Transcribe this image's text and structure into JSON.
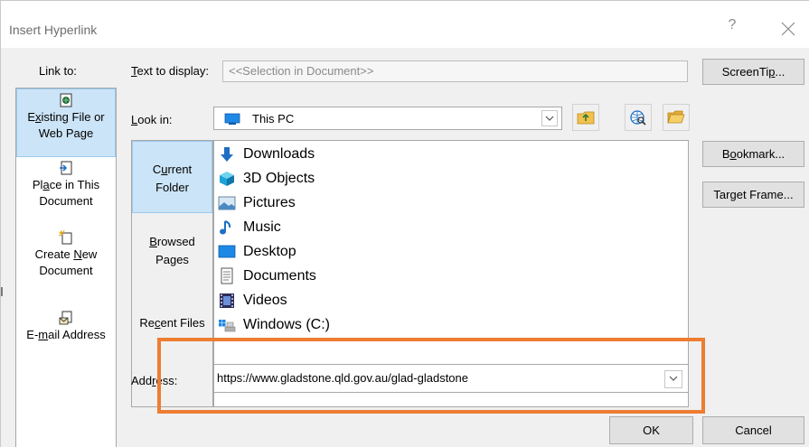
{
  "window": {
    "title": "Insert Hyperlink",
    "help_label": "?"
  },
  "link_to": {
    "label": "Link to:",
    "items": [
      {
        "line1_pre": "",
        "line1_key": "x",
        "line1_post": "isting File or",
        "line1_lead": "E",
        "line2": "Web Page",
        "icon": "existing-file-icon",
        "selected": true
      },
      {
        "line1": "Pl",
        "line1_key": "a",
        "line1_post": "ce in This",
        "line2": "Document",
        "icon": "place-in-document-icon"
      },
      {
        "line1": "Create ",
        "line1_key": "N",
        "line1_post": "ew",
        "line2": "Document",
        "icon": "create-new-document-icon"
      },
      {
        "line1": "E-",
        "line1_key": "m",
        "line1_post": "ail Address",
        "icon": "email-address-icon"
      }
    ]
  },
  "text_to_display": {
    "label_key": "T",
    "label_rest": "ext to display:",
    "value": "<<Selection in Document>>"
  },
  "look_in": {
    "label_key": "L",
    "label_rest": "ook in:",
    "value": "This PC"
  },
  "nav": {
    "current_folder_pre": "C",
    "current_folder_key": "u",
    "current_folder_post": "rrent",
    "current_folder_line2": "Folder",
    "browsed_key": "B",
    "browsed_rest": "rowsed",
    "browsed_line2": "Pages",
    "recent_pre": "Re",
    "recent_key": "c",
    "recent_post": "ent Files"
  },
  "files": [
    {
      "name": "Downloads",
      "icon": "downloads-icon"
    },
    {
      "name": "3D Objects",
      "icon": "3d-objects-icon"
    },
    {
      "name": "Pictures",
      "icon": "pictures-icon"
    },
    {
      "name": "Music",
      "icon": "music-icon"
    },
    {
      "name": "Desktop",
      "icon": "desktop-icon"
    },
    {
      "name": "Documents",
      "icon": "documents-icon"
    },
    {
      "name": "Videos",
      "icon": "videos-icon"
    },
    {
      "name": "Windows (C:)",
      "icon": "drive-icon"
    }
  ],
  "side_buttons": {
    "screentip_pre": "ScreenTi",
    "screentip_key": "p",
    "screentip_post": "...",
    "bookmark_pre": "B",
    "bookmark_key": "o",
    "bookmark_post": "okmark...",
    "target_pre": "Tar",
    "target_key": "g",
    "target_post": "et Frame..."
  },
  "address": {
    "label_pre": "Add",
    "label_key": "r",
    "label_post": "ess:",
    "value": "https://www.gladstone.qld.gov.au/glad-gladstone"
  },
  "buttons": {
    "ok": "OK",
    "cancel": "Cancel"
  },
  "colors": {
    "highlight": "#ed7d31",
    "selection": "#cce4f7"
  }
}
